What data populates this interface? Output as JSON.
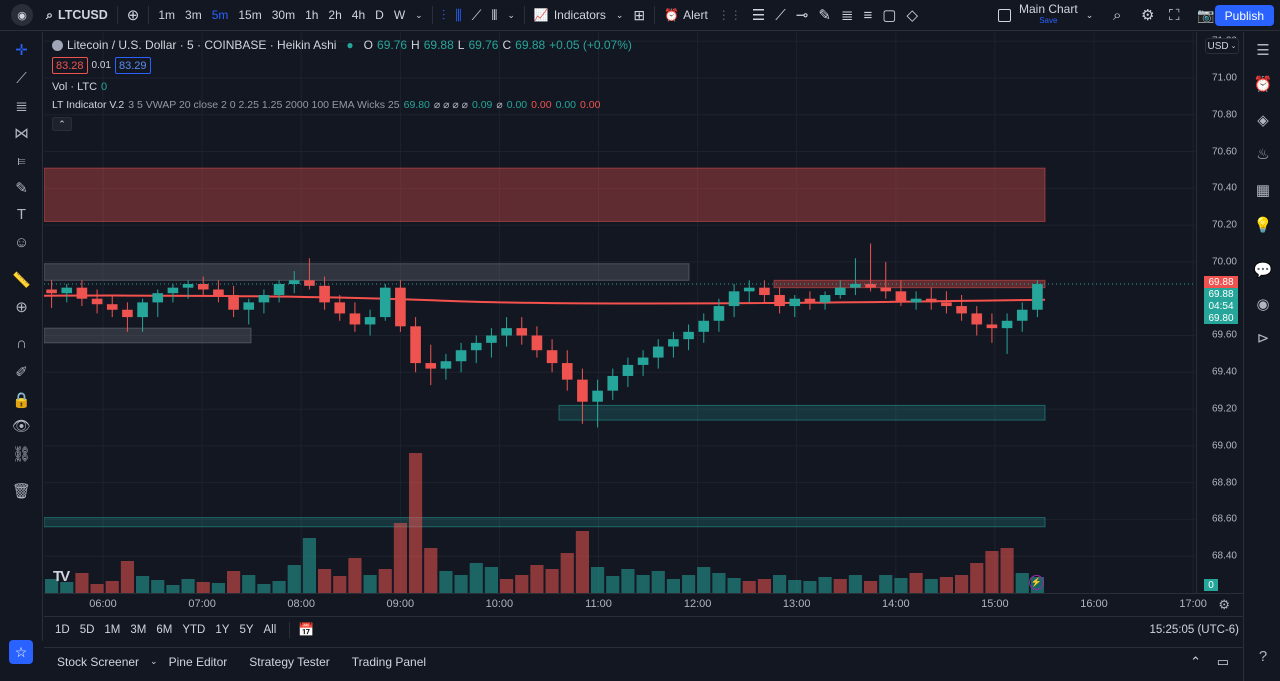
{
  "topbar": {
    "symbol": "LTCUSD",
    "intervals": [
      "1m",
      "3m",
      "5m",
      "15m",
      "30m",
      "1h",
      "2h",
      "4h",
      "D",
      "W"
    ],
    "active_interval": "5m",
    "indicators_label": "Indicators",
    "alert_label": "Alert",
    "main_chart_label": "Main Chart",
    "save_label": "Save",
    "publish_label": "Publish"
  },
  "legend": {
    "title": "Litecoin / U.S. Dollar · 5 · COINBASE · Heikin Ashi",
    "o_label": "O",
    "o_value": "69.76",
    "h_label": "H",
    "h_value": "69.88",
    "l_label": "L",
    "l_value": "69.76",
    "c_label": "C",
    "c_value": "69.88",
    "change": "+0.05 (+0.07%)",
    "bid": "83.28",
    "spread": "0.01",
    "ask": "83.29",
    "vol_label": "Vol · LTC",
    "vol_value": "0",
    "indicator_label": "LT Indicator V.2",
    "indicator_params": "3 5 VWAP 20 close 2 0 2.25 1.25 2000 100 EMA Wicks 25",
    "indicator_v1": "69.80",
    "indicator_sym": "⌀ ⌀ ⌀ ⌀",
    "indicator_v2": "0.09",
    "indicator_sym2": "⌀",
    "indicator_v3": "0.00",
    "indicator_v4": "0.00",
    "indicator_v5": "0.00",
    "indicator_v6": "0.00"
  },
  "price_axis": {
    "currency": "USD",
    "ticks": [
      "71.20",
      "71.00",
      "70.80",
      "70.60",
      "70.40",
      "70.20",
      "70.00",
      "69.60",
      "69.40",
      "69.20",
      "69.00",
      "68.80",
      "68.60",
      "68.40"
    ],
    "tags": [
      {
        "label": "69.88",
        "color": "#ef5350"
      },
      {
        "label": "69.88",
        "color": "#26a69a"
      },
      {
        "label": "04:54",
        "color": "#26a69a"
      },
      {
        "label": "69.80",
        "color": "#26a69a"
      }
    ],
    "vol_tag": "0"
  },
  "time_axis": {
    "ticks": [
      "06:00",
      "07:00",
      "08:00",
      "09:00",
      "10:00",
      "11:00",
      "12:00",
      "13:00",
      "14:00",
      "15:00",
      "16:00",
      "17:00"
    ]
  },
  "range_bar": {
    "items": [
      "1D",
      "5D",
      "1M",
      "3M",
      "6M",
      "YTD",
      "1Y",
      "5Y",
      "All"
    ],
    "clock": "15:25:05 (UTC-6)"
  },
  "bottom_bar": {
    "items": [
      "Stock Screener",
      "Pine Editor",
      "Strategy Tester",
      "Trading Panel"
    ]
  },
  "colors": {
    "up": "#26a69a",
    "down": "#ef5350",
    "accent": "#2962ff"
  },
  "chart_data": {
    "type": "candlestick",
    "symbol": "LTCUSD",
    "x_ticks": [
      "06:00",
      "07:00",
      "08:00",
      "09:00",
      "10:00",
      "11:00",
      "12:00",
      "13:00",
      "14:00",
      "15:00",
      "16:00",
      "17:00"
    ],
    "ylim": [
      68.2,
      71.25
    ],
    "zones": [
      {
        "from": 70.22,
        "to": 70.51,
        "color": "red"
      },
      {
        "from": 69.9,
        "to": 69.99,
        "color": "gray"
      },
      {
        "from": 69.56,
        "to": 69.64,
        "color": "gray"
      },
      {
        "from": 69.86,
        "to": 69.9,
        "color": "red"
      },
      {
        "from": 69.14,
        "to": 69.22,
        "color": "teal"
      },
      {
        "from": 68.56,
        "to": 68.61,
        "color": "teal"
      }
    ],
    "ema_level": 69.8,
    "last_price": 69.88,
    "candles": [
      {
        "o": 69.85,
        "h": 69.9,
        "l": 69.75,
        "c": 69.83
      },
      {
        "o": 69.83,
        "h": 69.88,
        "l": 69.78,
        "c": 69.86
      },
      {
        "o": 69.86,
        "h": 69.9,
        "l": 69.76,
        "c": 69.8
      },
      {
        "o": 69.8,
        "h": 69.85,
        "l": 69.72,
        "c": 69.77
      },
      {
        "o": 69.77,
        "h": 69.82,
        "l": 69.7,
        "c": 69.74
      },
      {
        "o": 69.74,
        "h": 69.78,
        "l": 69.62,
        "c": 69.7
      },
      {
        "o": 69.7,
        "h": 69.8,
        "l": 69.62,
        "c": 69.78
      },
      {
        "o": 69.78,
        "h": 69.85,
        "l": 69.7,
        "c": 69.83
      },
      {
        "o": 69.83,
        "h": 69.88,
        "l": 69.78,
        "c": 69.86
      },
      {
        "o": 69.86,
        "h": 69.9,
        "l": 69.8,
        "c": 69.88
      },
      {
        "o": 69.88,
        "h": 69.92,
        "l": 69.82,
        "c": 69.85
      },
      {
        "o": 69.85,
        "h": 69.9,
        "l": 69.78,
        "c": 69.82
      },
      {
        "o": 69.82,
        "h": 69.87,
        "l": 69.7,
        "c": 69.74
      },
      {
        "o": 69.74,
        "h": 69.8,
        "l": 69.66,
        "c": 69.78
      },
      {
        "o": 69.78,
        "h": 69.85,
        "l": 69.72,
        "c": 69.82
      },
      {
        "o": 69.82,
        "h": 69.9,
        "l": 69.78,
        "c": 69.88
      },
      {
        "o": 69.88,
        "h": 69.95,
        "l": 69.83,
        "c": 69.9
      },
      {
        "o": 69.9,
        "h": 70.02,
        "l": 69.85,
        "c": 69.87
      },
      {
        "o": 69.87,
        "h": 69.92,
        "l": 69.74,
        "c": 69.78
      },
      {
        "o": 69.78,
        "h": 69.82,
        "l": 69.68,
        "c": 69.72
      },
      {
        "o": 69.72,
        "h": 69.78,
        "l": 69.62,
        "c": 69.66
      },
      {
        "o": 69.66,
        "h": 69.74,
        "l": 69.6,
        "c": 69.7
      },
      {
        "o": 69.7,
        "h": 69.88,
        "l": 69.68,
        "c": 69.86
      },
      {
        "o": 69.86,
        "h": 69.9,
        "l": 69.62,
        "c": 69.65
      },
      {
        "o": 69.65,
        "h": 69.7,
        "l": 69.4,
        "c": 69.45
      },
      {
        "o": 69.45,
        "h": 69.55,
        "l": 69.33,
        "c": 69.42
      },
      {
        "o": 69.42,
        "h": 69.5,
        "l": 69.36,
        "c": 69.46
      },
      {
        "o": 69.46,
        "h": 69.56,
        "l": 69.4,
        "c": 69.52
      },
      {
        "o": 69.52,
        "h": 69.6,
        "l": 69.45,
        "c": 69.56
      },
      {
        "o": 69.56,
        "h": 69.64,
        "l": 69.48,
        "c": 69.6
      },
      {
        "o": 69.6,
        "h": 69.7,
        "l": 69.54,
        "c": 69.64
      },
      {
        "o": 69.64,
        "h": 69.7,
        "l": 69.55,
        "c": 69.6
      },
      {
        "o": 69.6,
        "h": 69.65,
        "l": 69.48,
        "c": 69.52
      },
      {
        "o": 69.52,
        "h": 69.58,
        "l": 69.4,
        "c": 69.45
      },
      {
        "o": 69.45,
        "h": 69.52,
        "l": 69.3,
        "c": 69.36
      },
      {
        "o": 69.36,
        "h": 69.42,
        "l": 69.12,
        "c": 69.24
      },
      {
        "o": 69.24,
        "h": 69.36,
        "l": 69.1,
        "c": 69.3
      },
      {
        "o": 69.3,
        "h": 69.42,
        "l": 69.25,
        "c": 69.38
      },
      {
        "o": 69.38,
        "h": 69.48,
        "l": 69.32,
        "c": 69.44
      },
      {
        "o": 69.44,
        "h": 69.52,
        "l": 69.38,
        "c": 69.48
      },
      {
        "o": 69.48,
        "h": 69.58,
        "l": 69.42,
        "c": 69.54
      },
      {
        "o": 69.54,
        "h": 69.62,
        "l": 69.48,
        "c": 69.58
      },
      {
        "o": 69.58,
        "h": 69.66,
        "l": 69.52,
        "c": 69.62
      },
      {
        "o": 69.62,
        "h": 69.72,
        "l": 69.56,
        "c": 69.68
      },
      {
        "o": 69.68,
        "h": 69.8,
        "l": 69.62,
        "c": 69.76
      },
      {
        "o": 69.76,
        "h": 69.88,
        "l": 69.7,
        "c": 69.84
      },
      {
        "o": 69.84,
        "h": 69.9,
        "l": 69.78,
        "c": 69.86
      },
      {
        "o": 69.86,
        "h": 69.9,
        "l": 69.78,
        "c": 69.82
      },
      {
        "o": 69.82,
        "h": 69.86,
        "l": 69.72,
        "c": 69.76
      },
      {
        "o": 69.76,
        "h": 69.82,
        "l": 69.7,
        "c": 69.8
      },
      {
        "o": 69.8,
        "h": 69.84,
        "l": 69.74,
        "c": 69.78
      },
      {
        "o": 69.78,
        "h": 69.84,
        "l": 69.74,
        "c": 69.82
      },
      {
        "o": 69.82,
        "h": 69.9,
        "l": 69.8,
        "c": 69.86
      },
      {
        "o": 69.86,
        "h": 70.02,
        "l": 69.82,
        "c": 69.88
      },
      {
        "o": 69.88,
        "h": 70.1,
        "l": 69.84,
        "c": 69.86
      },
      {
        "o": 69.86,
        "h": 70.0,
        "l": 69.8,
        "c": 69.84
      },
      {
        "o": 69.84,
        "h": 69.9,
        "l": 69.76,
        "c": 69.78
      },
      {
        "o": 69.78,
        "h": 69.84,
        "l": 69.74,
        "c": 69.8
      },
      {
        "o": 69.8,
        "h": 69.86,
        "l": 69.74,
        "c": 69.78
      },
      {
        "o": 69.78,
        "h": 69.84,
        "l": 69.72,
        "c": 69.76
      },
      {
        "o": 69.76,
        "h": 69.82,
        "l": 69.68,
        "c": 69.72
      },
      {
        "o": 69.72,
        "h": 69.76,
        "l": 69.6,
        "c": 69.66
      },
      {
        "o": 69.66,
        "h": 69.72,
        "l": 69.56,
        "c": 69.64
      },
      {
        "o": 69.64,
        "h": 69.72,
        "l": 69.5,
        "c": 69.68
      },
      {
        "o": 69.68,
        "h": 69.78,
        "l": 69.62,
        "c": 69.74
      },
      {
        "o": 69.74,
        "h": 69.9,
        "l": 69.7,
        "c": 69.88
      }
    ],
    "volume": [
      {
        "v": 14,
        "up": true
      },
      {
        "v": 11,
        "up": true
      },
      {
        "v": 20,
        "up": false
      },
      {
        "v": 9,
        "up": false
      },
      {
        "v": 12,
        "up": false
      },
      {
        "v": 32,
        "up": false
      },
      {
        "v": 17,
        "up": true
      },
      {
        "v": 13,
        "up": true
      },
      {
        "v": 8,
        "up": true
      },
      {
        "v": 14,
        "up": true
      },
      {
        "v": 11,
        "up": false
      },
      {
        "v": 10,
        "up": true
      },
      {
        "v": 22,
        "up": false
      },
      {
        "v": 18,
        "up": true
      },
      {
        "v": 9,
        "up": true
      },
      {
        "v": 12,
        "up": true
      },
      {
        "v": 28,
        "up": true
      },
      {
        "v": 55,
        "up": true
      },
      {
        "v": 24,
        "up": false
      },
      {
        "v": 17,
        "up": false
      },
      {
        "v": 35,
        "up": false
      },
      {
        "v": 18,
        "up": true
      },
      {
        "v": 24,
        "up": false
      },
      {
        "v": 70,
        "up": false
      },
      {
        "v": 140,
        "up": false
      },
      {
        "v": 45,
        "up": false
      },
      {
        "v": 22,
        "up": true
      },
      {
        "v": 18,
        "up": true
      },
      {
        "v": 30,
        "up": true
      },
      {
        "v": 26,
        "up": true
      },
      {
        "v": 14,
        "up": false
      },
      {
        "v": 18,
        "up": false
      },
      {
        "v": 28,
        "up": false
      },
      {
        "v": 24,
        "up": false
      },
      {
        "v": 40,
        "up": false
      },
      {
        "v": 62,
        "up": false
      },
      {
        "v": 26,
        "up": true
      },
      {
        "v": 17,
        "up": true
      },
      {
        "v": 24,
        "up": true
      },
      {
        "v": 18,
        "up": true
      },
      {
        "v": 22,
        "up": true
      },
      {
        "v": 14,
        "up": true
      },
      {
        "v": 18,
        "up": true
      },
      {
        "v": 26,
        "up": true
      },
      {
        "v": 20,
        "up": true
      },
      {
        "v": 15,
        "up": true
      },
      {
        "v": 12,
        "up": false
      },
      {
        "v": 14,
        "up": false
      },
      {
        "v": 18,
        "up": true
      },
      {
        "v": 13,
        "up": true
      },
      {
        "v": 12,
        "up": true
      },
      {
        "v": 16,
        "up": true
      },
      {
        "v": 14,
        "up": false
      },
      {
        "v": 18,
        "up": true
      },
      {
        "v": 12,
        "up": false
      },
      {
        "v": 18,
        "up": true
      },
      {
        "v": 15,
        "up": true
      },
      {
        "v": 20,
        "up": false
      },
      {
        "v": 14,
        "up": true
      },
      {
        "v": 16,
        "up": false
      },
      {
        "v": 18,
        "up": false
      },
      {
        "v": 30,
        "up": false
      },
      {
        "v": 42,
        "up": false
      },
      {
        "v": 45,
        "up": false
      },
      {
        "v": 20,
        "up": true
      },
      {
        "v": 16,
        "up": true
      }
    ]
  }
}
